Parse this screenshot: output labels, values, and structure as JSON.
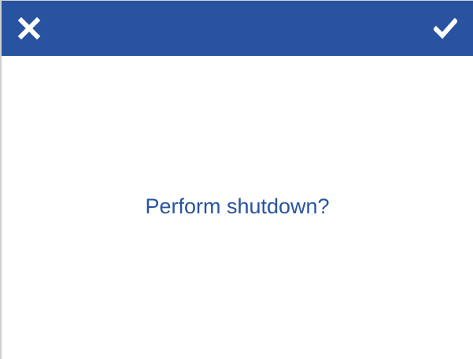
{
  "header": {
    "close_icon": "close-icon",
    "confirm_icon": "checkmark-icon",
    "background_color": "#2853a0"
  },
  "dialog": {
    "message": "Perform shutdown?",
    "text_color": "#2853a0"
  }
}
